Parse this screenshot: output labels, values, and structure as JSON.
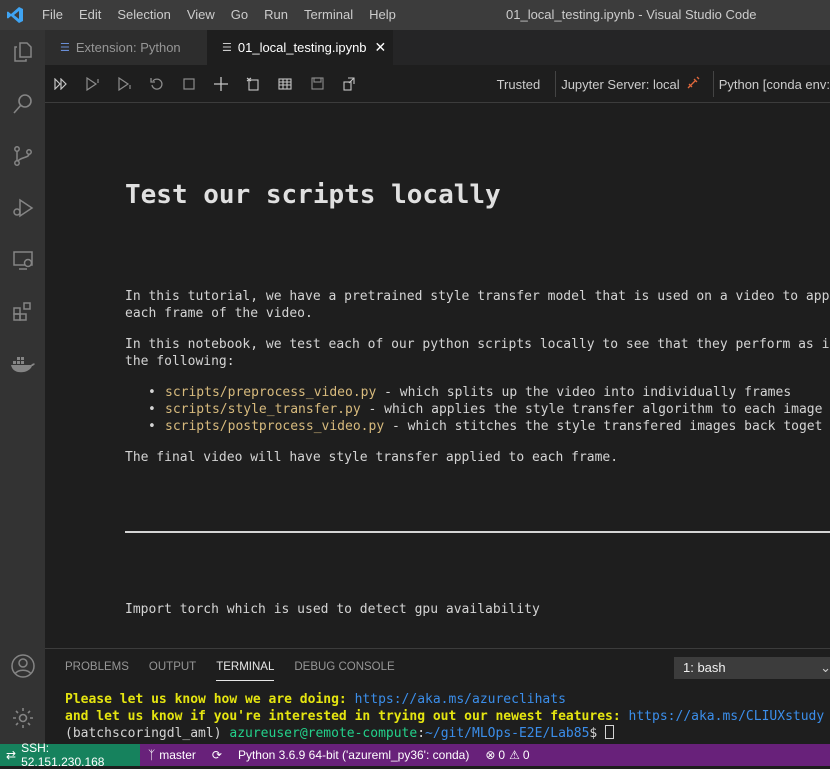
{
  "titlebar": {
    "menu": [
      "File",
      "Edit",
      "Selection",
      "View",
      "Go",
      "Run",
      "Terminal",
      "Help"
    ],
    "window_title": "01_local_testing.ipynb - Visual Studio Code"
  },
  "activity_icons": [
    "files-icon",
    "search-icon",
    "source-control-icon",
    "run-debug-icon",
    "remote-explorer-icon",
    "extensions-icon",
    "docker-icon",
    "account-icon",
    "settings-gear-icon"
  ],
  "tabs": [
    {
      "label": "Extension: Python",
      "active": false
    },
    {
      "label": "01_local_testing.ipynb",
      "active": true
    }
  ],
  "notebook_toolbar": {
    "trusted": "Trusted",
    "jupyter_server": "Jupyter Server: local",
    "kernel": "Python [conda env:"
  },
  "notebook": {
    "heading": "Test our scripts locally",
    "para1_line1": "In this tutorial, we have a pretrained style transfer model that is used on a video to apply",
    "para1_line2": "each frame of the video.",
    "para2_line1": "In this notebook, we test each of our python scripts locally to see that they perform as int",
    "para2_line2": "the following:",
    "bullets": [
      {
        "path": "scripts/preprocess_video.py",
        "desc": " - which splits up the video into individually frames"
      },
      {
        "path": "scripts/style_transfer.py",
        "desc": " - which applies the style transfer algorithm to each image"
      },
      {
        "path": "scripts/postprocess_video.py",
        "desc": " - which stitches the style transfered images back toget"
      }
    ],
    "para3": "The final video will have style transfer applied to each frame.",
    "para4": "Import torch which is used to detect gpu availability"
  },
  "panel": {
    "tabs": [
      "PROBLEMS",
      "OUTPUT",
      "TERMINAL",
      "DEBUG CONSOLE"
    ],
    "active_tab": "TERMINAL",
    "terminal_select": "1: bash",
    "terminal": {
      "line1_text": "Please let us know how we are doing: ",
      "line1_link": "https://aka.ms/azureclihats",
      "line2_text": "and let us know if you're interested in trying out our newest features: ",
      "line2_link": "https://aka.ms/CLIUXstudy",
      "prompt_env": "(batchscoringdl_aml) ",
      "prompt_user": "azureuser@remote-compute",
      "prompt_colon": ":",
      "prompt_path": "~/git/MLOps-E2E/Lab85",
      "prompt_end": "$ "
    }
  },
  "statusbar": {
    "remote": "SSH: 52.151.230.168",
    "branch": "master",
    "interpreter": "Python 3.6.9 64-bit ('azureml_py36': conda)",
    "errors": "0",
    "warnings": "0"
  },
  "colors": {
    "statusbar": "#68217a",
    "remote": "#16825d",
    "activity": "#333333",
    "editor": "#1e1e1e"
  }
}
